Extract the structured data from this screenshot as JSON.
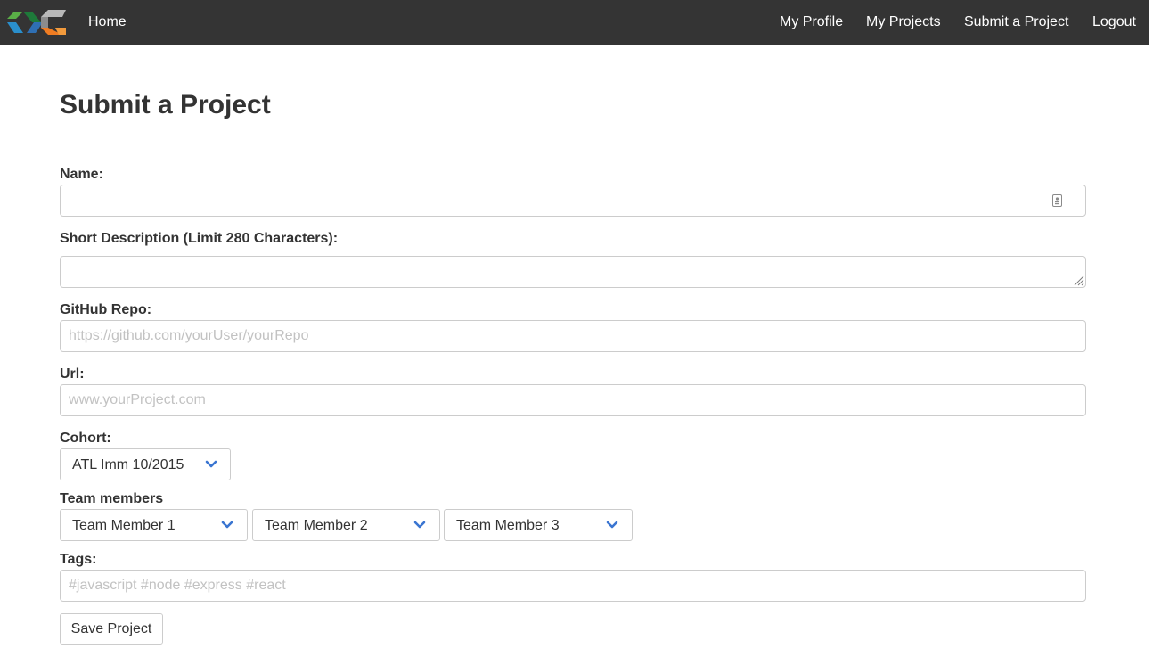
{
  "navbar": {
    "logo_icon": "logo-icon",
    "home_label": "Home",
    "links": [
      "My Profile",
      "My Projects",
      "Submit a Project",
      "Logout"
    ]
  },
  "page": {
    "title": "Submit a Project"
  },
  "form": {
    "name": {
      "label": "Name:",
      "value": "",
      "placeholder": ""
    },
    "description": {
      "label": "Short Description (Limit 280 Characters):",
      "value": ""
    },
    "github": {
      "label": "GitHub Repo:",
      "value": "",
      "placeholder": "https://github.com/yourUser/yourRepo"
    },
    "url": {
      "label": "Url:",
      "value": "",
      "placeholder": "www.yourProject.com"
    },
    "cohort": {
      "label": "Cohort:",
      "selected": "ATL Imm 10/2015"
    },
    "team": {
      "label": "Team members",
      "members": [
        "Team Member 1",
        "Team Member 2",
        "Team Member 3"
      ]
    },
    "tags": {
      "label": "Tags:",
      "value": "",
      "placeholder": "#javascript #node #express #react"
    },
    "save_label": "Save Project"
  },
  "colors": {
    "navbar_bg": "#343434",
    "chevron": "#3a75d1",
    "logo_green": "#5aae47",
    "logo_blue": "#2a8fcc",
    "logo_gray": "#9a9a9a",
    "logo_orange": "#ef7c22"
  }
}
